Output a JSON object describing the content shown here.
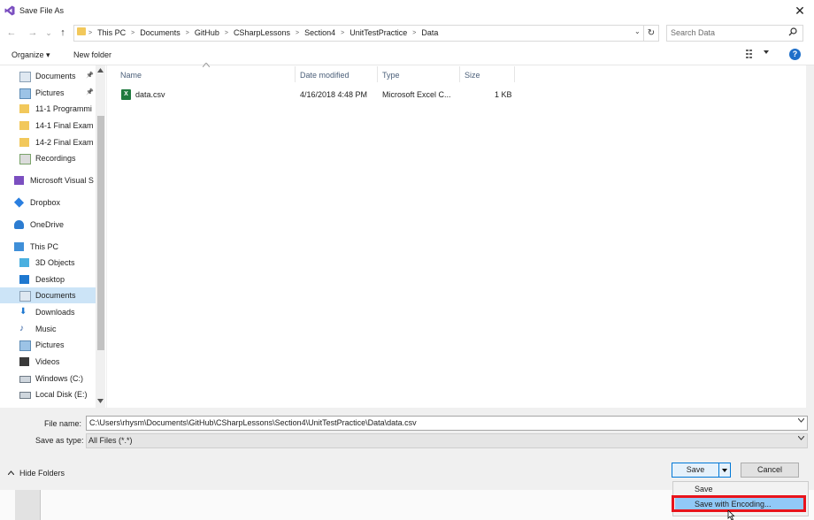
{
  "window": {
    "title": "Save File As",
    "close": "✕"
  },
  "nav": {
    "back": "←",
    "forward": "→",
    "dropdown": "⌄",
    "up": "↑",
    "breadcrumbs": [
      "This PC",
      "Documents",
      "GitHub",
      "CSharpLessons",
      "Section4",
      "UnitTestPractice",
      "Data"
    ],
    "sep": ">",
    "refresh": "↻",
    "search_placeholder": "Search Data"
  },
  "toolbar": {
    "organize": "Organize ▾",
    "new_folder": "New folder",
    "help": "?"
  },
  "sidebar": {
    "items": [
      {
        "label": "Documents",
        "icon": "documents-icon",
        "pinned": true
      },
      {
        "label": "Pictures",
        "icon": "pictures-icon",
        "pinned": true
      },
      {
        "label": "11-1 Programmi",
        "icon": "folder-icon"
      },
      {
        "label": "14-1 Final Exam",
        "icon": "folder-icon"
      },
      {
        "label": "14-2 Final Exam",
        "icon": "folder-icon"
      },
      {
        "label": "Recordings",
        "icon": "recordings-icon"
      },
      {
        "label": "Microsoft Visual S",
        "icon": "visual-studio-icon"
      },
      {
        "label": "Dropbox",
        "icon": "dropbox-icon"
      },
      {
        "label": "OneDrive",
        "icon": "onedrive-icon"
      },
      {
        "label": "This PC",
        "icon": "this-pc-icon"
      },
      {
        "label": "3D Objects",
        "icon": "3d-objects-icon"
      },
      {
        "label": "Desktop",
        "icon": "desktop-icon"
      },
      {
        "label": "Documents",
        "icon": "documents-icon",
        "selected": true
      },
      {
        "label": "Downloads",
        "icon": "downloads-icon"
      },
      {
        "label": "Music",
        "icon": "music-icon"
      },
      {
        "label": "Pictures",
        "icon": "pictures-icon"
      },
      {
        "label": "Videos",
        "icon": "videos-icon"
      },
      {
        "label": "Windows (C:)",
        "icon": "drive-icon"
      },
      {
        "label": "Local Disk (E:)",
        "icon": "drive-icon"
      }
    ]
  },
  "filelist": {
    "columns": [
      "Name",
      "Date modified",
      "Type",
      "Size"
    ],
    "rows": [
      {
        "name": "data.csv",
        "date": "4/16/2018 4:48 PM",
        "type": "Microsoft Excel C...",
        "size": "1 KB",
        "icon_letter": "X"
      }
    ]
  },
  "form": {
    "file_name_label": "File name:",
    "file_name_value": "C:\\Users\\rhysm\\Documents\\GitHub\\CSharpLessons\\Section4\\UnitTestPractice\\Data\\data.csv",
    "save_as_type_label": "Save as type:",
    "save_as_type_value": "All Files (*.*)"
  },
  "footer": {
    "hide_folders": "Hide Folders",
    "save": "Save",
    "cancel": "Cancel",
    "menu": {
      "save": "Save",
      "save_with_encoding": "Save with Encoding..."
    }
  },
  "colors": {
    "accent": "#0078d7",
    "selected": "#cce4f7",
    "highlight_box": "#e8141c",
    "menu_hover": "#91c9f7"
  }
}
